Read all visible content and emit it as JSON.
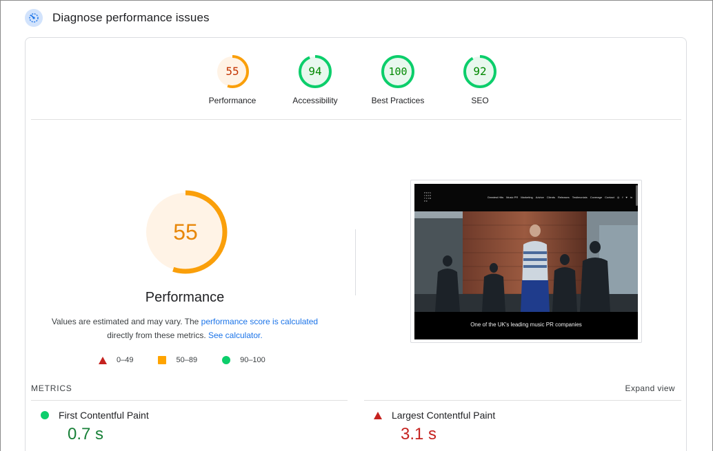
{
  "header": {
    "title": "Diagnose performance issues",
    "icon": "speed-gauge-icon"
  },
  "category_scores": [
    {
      "score": "55",
      "label": "Performance",
      "fraction": 0.55,
      "color": "#fa9f0a",
      "fill": "#fff3e6",
      "text_color": "#c33300"
    },
    {
      "score": "94",
      "label": "Accessibility",
      "fraction": 0.94,
      "color": "#0cce6b",
      "fill": "#e8f8ee",
      "text_color": "#008800"
    },
    {
      "score": "100",
      "label": "Best Practices",
      "fraction": 1.0,
      "color": "#0cce6b",
      "fill": "#e8f8ee",
      "text_color": "#008800"
    },
    {
      "score": "92",
      "label": "SEO",
      "fraction": 0.92,
      "color": "#0cce6b",
      "fill": "#e8f8ee",
      "text_color": "#008800"
    }
  ],
  "performance": {
    "score": "55",
    "fraction": 0.55,
    "title": "Performance",
    "desc_prefix": "Values are estimated and may vary. The ",
    "desc_link1": "performance score is calculated",
    "desc_middle": " directly from these metrics. ",
    "desc_link2": "See calculator.",
    "colors": {
      "arc": "#fa9f0a",
      "fill": "#fff3e6",
      "text": "#e8870a"
    }
  },
  "legend": {
    "fail": "0–49",
    "average": "50–89",
    "pass": "90–100"
  },
  "screenshot": {
    "logo": "PROS CRIP TION PR",
    "nav_links": [
      "Greatest Hits",
      "Music PR",
      "Marketing",
      "Advice",
      "Clients",
      "Releases",
      "Testimonials",
      "Coverage",
      "Contact"
    ],
    "social_icons": [
      "instagram-icon",
      "facebook-icon",
      "twitter-icon",
      "linkedin-icon"
    ],
    "social_glyphs": [
      "◎",
      "f",
      "♥",
      "in"
    ],
    "caption": "One of the UK's leading music PR companies"
  },
  "metrics": {
    "title": "METRICS",
    "expand_label": "Expand view",
    "items": [
      {
        "name": "First Contentful Paint",
        "value": "0.7 s",
        "status": "pass"
      },
      {
        "name": "Largest Contentful Paint",
        "value": "3.1 s",
        "status": "fail"
      }
    ]
  }
}
